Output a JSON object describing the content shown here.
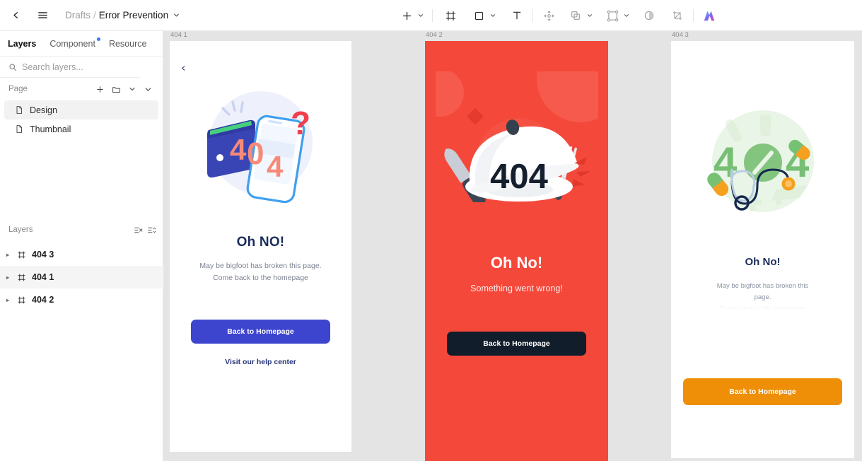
{
  "topbar": {
    "back_icon": "chevron-left-icon",
    "menu_icon": "hamburger-menu-icon",
    "breadcrumb": {
      "parent": "Drafts",
      "separator": "/",
      "file": "Error Prevention",
      "caret": "chevron-down-icon"
    },
    "tools": [
      {
        "name": "add-tool",
        "icon": "plus-icon",
        "caret": true
      },
      {
        "name": "frame-tool",
        "icon": "frame-icon",
        "caret": false
      },
      {
        "name": "shape-tool",
        "icon": "square-icon",
        "caret": true
      },
      {
        "name": "text-tool",
        "icon": "text-t-icon",
        "caret": false
      },
      {
        "name": "move-tool",
        "icon": "move-anchor-icon",
        "caret": false
      },
      {
        "name": "boolean-tool",
        "icon": "union-shapes-icon",
        "caret": true
      },
      {
        "name": "component-tool",
        "icon": "component-nodes-icon",
        "caret": true
      },
      {
        "name": "mask-tool",
        "icon": "contrast-circle-icon",
        "caret": false
      },
      {
        "name": "crop-tool",
        "icon": "crop-icon",
        "caret": false
      },
      {
        "name": "ai-tool",
        "icon": "gradient-logo-icon",
        "caret": false
      }
    ]
  },
  "sidebar": {
    "tabs": [
      {
        "label": "Layers",
        "active": true,
        "badge": false
      },
      {
        "label": "Component",
        "active": false,
        "badge": true
      },
      {
        "label": "Resource",
        "active": false,
        "badge": false
      }
    ],
    "search": {
      "placeholder": "Search layers...",
      "value": "",
      "icon": "search-icon"
    },
    "page_section": {
      "label": "Page",
      "actions": [
        "plus-icon",
        "folder-icon",
        "chevron-down-icon",
        "chevron-down-icon"
      ]
    },
    "pages": [
      {
        "label": "Design",
        "icon": "page-file-icon",
        "selected": true
      },
      {
        "label": "Thumbnail",
        "icon": "page-file-icon",
        "selected": false
      }
    ],
    "layers_section": {
      "label": "Layers",
      "actions": [
        "filter-list-icon",
        "sort-list-icon"
      ]
    },
    "layers": [
      {
        "label": "404 3",
        "icon": "frame-icon",
        "selected": false
      },
      {
        "label": "404 1",
        "icon": "frame-icon",
        "selected": true
      },
      {
        "label": "404 2",
        "icon": "frame-icon",
        "selected": false
      }
    ]
  },
  "canvas": {
    "background_color": "#e4e4e4",
    "frames": [
      {
        "label": "404 1",
        "background_color": "#ffffff",
        "back_icon": "chevron-left-icon",
        "illustration": "wallet-phone-404-question-illustration",
        "title": "Oh NO!",
        "subtitle_line1": "May be bigfoot has broken this page.",
        "subtitle_line2": "Come back to the homepage",
        "button_label": "Back to Homepage",
        "button_color": "#3d45cf",
        "link_label": "Visit our help center",
        "title_color": "#1b2d5b"
      },
      {
        "label": "404 2",
        "background_color": "#f4483a",
        "illustration": "food-cloche-plate-cutlery-404-illustration",
        "title": "Oh No!",
        "subtitle": "Something went wrong!",
        "button_label": "Back to Homepage",
        "button_color": "#111d2b",
        "title_color": "#ffffff"
      },
      {
        "label": "404 3",
        "background_color": "#ffffff",
        "illustration": "medical-stethoscope-pills-404-illustration",
        "title": "Oh No!",
        "subtitle_line1": "May be bigfoot has broken this",
        "subtitle_line2": "page.",
        "subtitle_line3_clipped": "Come back to the homepage",
        "button_label": "Back to Homepage",
        "button_color": "#ef8f08",
        "title_color": "#1b2d5b"
      }
    ]
  }
}
